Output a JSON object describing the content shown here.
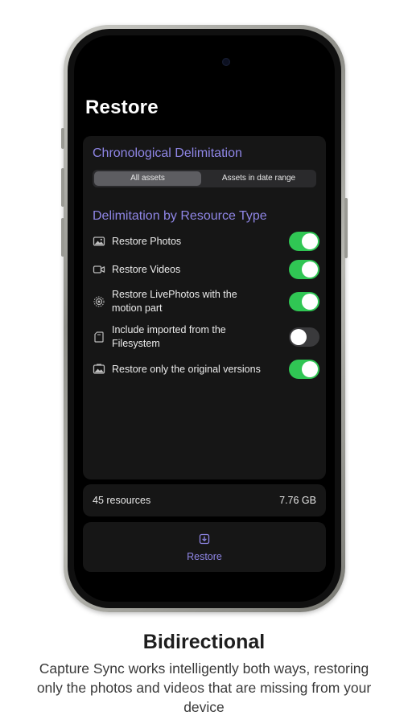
{
  "screen": {
    "title": "Restore"
  },
  "chronological": {
    "heading": "Chronological Delimitation",
    "options": [
      "All assets",
      "Assets in date range"
    ],
    "selected": "All assets"
  },
  "resource_type": {
    "heading": "Delimitation by Resource Type",
    "items": [
      {
        "label": "Restore Photos",
        "icon": "photo-icon",
        "enabled": true
      },
      {
        "label": "Restore Videos",
        "icon": "video-icon",
        "enabled": true
      },
      {
        "label": "Restore LivePhotos with the motion part",
        "icon": "livephoto-icon",
        "enabled": true
      },
      {
        "label": "Include imported from the Filesystem",
        "icon": "file-icon",
        "enabled": false
      },
      {
        "label": "Restore only the original versions",
        "icon": "original-photo-icon",
        "enabled": true
      }
    ]
  },
  "summary": {
    "count": "45 resources",
    "size": "7.76 GB"
  },
  "action": {
    "label": "Restore",
    "icon": "download-icon"
  },
  "caption": {
    "title": "Bidirectional",
    "body": "Capture Sync works intelligently both ways, restoring only the photos and videos that are missing from your device"
  },
  "colors": {
    "accent": "#8f86e6",
    "toggle_on": "#30c654",
    "background": "#000000"
  }
}
